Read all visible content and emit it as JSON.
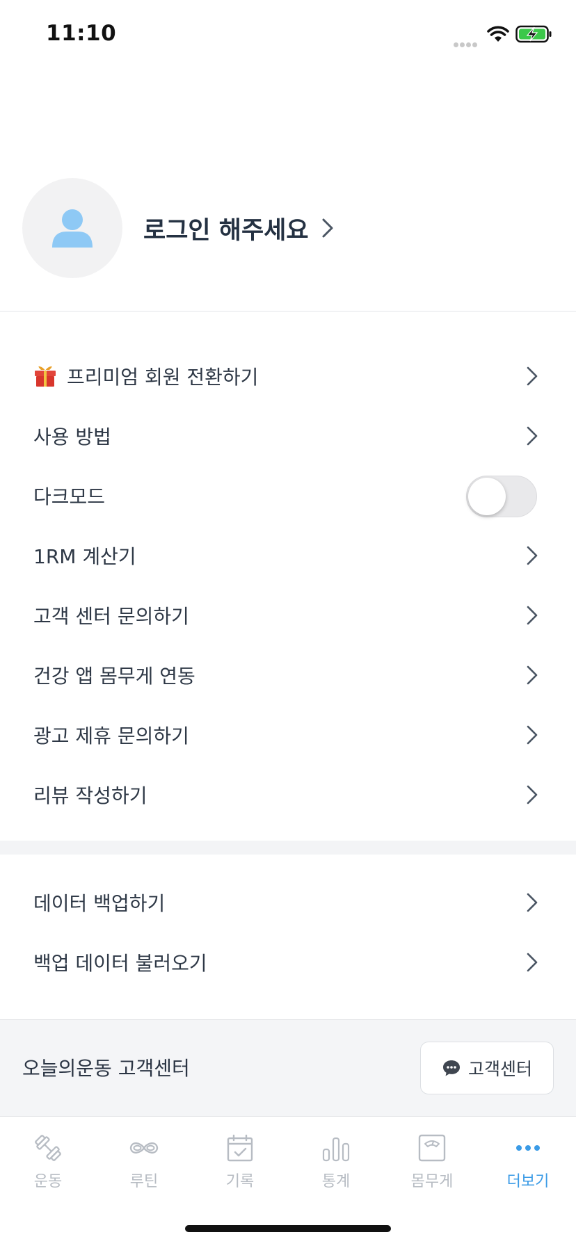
{
  "status_bar": {
    "time": "11:10"
  },
  "profile": {
    "login_text": "로그인 해주세요"
  },
  "menu_group_1": [
    {
      "label": "프리미엄 회원 전환하기",
      "icon": "gift-icon"
    },
    {
      "label": "사용 방법"
    },
    {
      "label": "다크모드",
      "toggle": false
    },
    {
      "label": "1RM 계산기"
    },
    {
      "label": "고객 센터 문의하기"
    },
    {
      "label": "건강 앱 몸무게 연동"
    },
    {
      "label": "광고 제휴 문의하기"
    },
    {
      "label": "리뷰 작성하기"
    }
  ],
  "menu_group_2": [
    {
      "label": "데이터 백업하기"
    },
    {
      "label": "백업 데이터 불러오기"
    }
  ],
  "footer": {
    "title": "오늘의운동 고객센터",
    "support_button": "고객센터"
  },
  "tabs": [
    {
      "label": "운동",
      "icon": "dumbbell-icon"
    },
    {
      "label": "루틴",
      "icon": "infinity-icon"
    },
    {
      "label": "기록",
      "icon": "calendar-check-icon"
    },
    {
      "label": "통계",
      "icon": "bar-chart-icon"
    },
    {
      "label": "몸무게",
      "icon": "scale-icon"
    },
    {
      "label": "더보기",
      "icon": "more-dots-icon",
      "active": true
    }
  ],
  "colors": {
    "accent": "#3b9be6",
    "inactive": "#b7bcc3",
    "avatar_person": "#8ec9f5"
  }
}
